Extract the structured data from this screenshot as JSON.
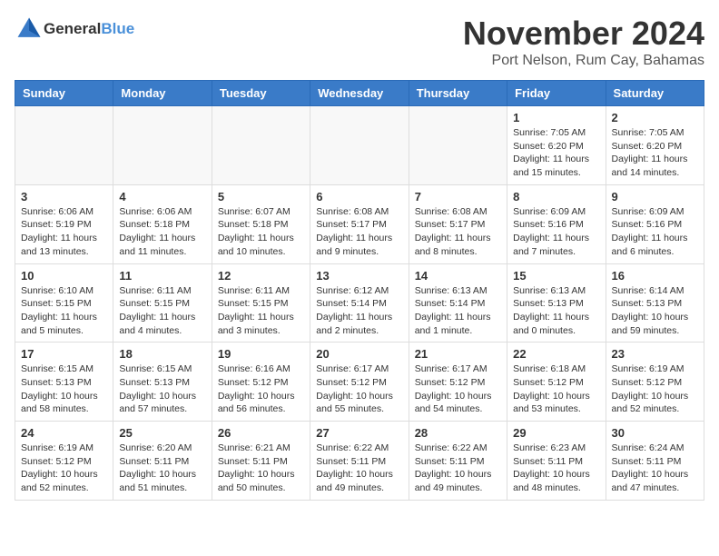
{
  "header": {
    "logo_general": "General",
    "logo_blue": "Blue",
    "month_title": "November 2024",
    "subtitle": "Port Nelson, Rum Cay, Bahamas"
  },
  "weekdays": [
    "Sunday",
    "Monday",
    "Tuesday",
    "Wednesday",
    "Thursday",
    "Friday",
    "Saturday"
  ],
  "weeks": [
    [
      {
        "day": "",
        "info": ""
      },
      {
        "day": "",
        "info": ""
      },
      {
        "day": "",
        "info": ""
      },
      {
        "day": "",
        "info": ""
      },
      {
        "day": "",
        "info": ""
      },
      {
        "day": "1",
        "info": "Sunrise: 7:05 AM\nSunset: 6:20 PM\nDaylight: 11 hours and 15 minutes."
      },
      {
        "day": "2",
        "info": "Sunrise: 7:05 AM\nSunset: 6:20 PM\nDaylight: 11 hours and 14 minutes."
      }
    ],
    [
      {
        "day": "3",
        "info": "Sunrise: 6:06 AM\nSunset: 5:19 PM\nDaylight: 11 hours and 13 minutes."
      },
      {
        "day": "4",
        "info": "Sunrise: 6:06 AM\nSunset: 5:18 PM\nDaylight: 11 hours and 11 minutes."
      },
      {
        "day": "5",
        "info": "Sunrise: 6:07 AM\nSunset: 5:18 PM\nDaylight: 11 hours and 10 minutes."
      },
      {
        "day": "6",
        "info": "Sunrise: 6:08 AM\nSunset: 5:17 PM\nDaylight: 11 hours and 9 minutes."
      },
      {
        "day": "7",
        "info": "Sunrise: 6:08 AM\nSunset: 5:17 PM\nDaylight: 11 hours and 8 minutes."
      },
      {
        "day": "8",
        "info": "Sunrise: 6:09 AM\nSunset: 5:16 PM\nDaylight: 11 hours and 7 minutes."
      },
      {
        "day": "9",
        "info": "Sunrise: 6:09 AM\nSunset: 5:16 PM\nDaylight: 11 hours and 6 minutes."
      }
    ],
    [
      {
        "day": "10",
        "info": "Sunrise: 6:10 AM\nSunset: 5:15 PM\nDaylight: 11 hours and 5 minutes."
      },
      {
        "day": "11",
        "info": "Sunrise: 6:11 AM\nSunset: 5:15 PM\nDaylight: 11 hours and 4 minutes."
      },
      {
        "day": "12",
        "info": "Sunrise: 6:11 AM\nSunset: 5:15 PM\nDaylight: 11 hours and 3 minutes."
      },
      {
        "day": "13",
        "info": "Sunrise: 6:12 AM\nSunset: 5:14 PM\nDaylight: 11 hours and 2 minutes."
      },
      {
        "day": "14",
        "info": "Sunrise: 6:13 AM\nSunset: 5:14 PM\nDaylight: 11 hours and 1 minute."
      },
      {
        "day": "15",
        "info": "Sunrise: 6:13 AM\nSunset: 5:13 PM\nDaylight: 11 hours and 0 minutes."
      },
      {
        "day": "16",
        "info": "Sunrise: 6:14 AM\nSunset: 5:13 PM\nDaylight: 10 hours and 59 minutes."
      }
    ],
    [
      {
        "day": "17",
        "info": "Sunrise: 6:15 AM\nSunset: 5:13 PM\nDaylight: 10 hours and 58 minutes."
      },
      {
        "day": "18",
        "info": "Sunrise: 6:15 AM\nSunset: 5:13 PM\nDaylight: 10 hours and 57 minutes."
      },
      {
        "day": "19",
        "info": "Sunrise: 6:16 AM\nSunset: 5:12 PM\nDaylight: 10 hours and 56 minutes."
      },
      {
        "day": "20",
        "info": "Sunrise: 6:17 AM\nSunset: 5:12 PM\nDaylight: 10 hours and 55 minutes."
      },
      {
        "day": "21",
        "info": "Sunrise: 6:17 AM\nSunset: 5:12 PM\nDaylight: 10 hours and 54 minutes."
      },
      {
        "day": "22",
        "info": "Sunrise: 6:18 AM\nSunset: 5:12 PM\nDaylight: 10 hours and 53 minutes."
      },
      {
        "day": "23",
        "info": "Sunrise: 6:19 AM\nSunset: 5:12 PM\nDaylight: 10 hours and 52 minutes."
      }
    ],
    [
      {
        "day": "24",
        "info": "Sunrise: 6:19 AM\nSunset: 5:12 PM\nDaylight: 10 hours and 52 minutes."
      },
      {
        "day": "25",
        "info": "Sunrise: 6:20 AM\nSunset: 5:11 PM\nDaylight: 10 hours and 51 minutes."
      },
      {
        "day": "26",
        "info": "Sunrise: 6:21 AM\nSunset: 5:11 PM\nDaylight: 10 hours and 50 minutes."
      },
      {
        "day": "27",
        "info": "Sunrise: 6:22 AM\nSunset: 5:11 PM\nDaylight: 10 hours and 49 minutes."
      },
      {
        "day": "28",
        "info": "Sunrise: 6:22 AM\nSunset: 5:11 PM\nDaylight: 10 hours and 49 minutes."
      },
      {
        "day": "29",
        "info": "Sunrise: 6:23 AM\nSunset: 5:11 PM\nDaylight: 10 hours and 48 minutes."
      },
      {
        "day": "30",
        "info": "Sunrise: 6:24 AM\nSunset: 5:11 PM\nDaylight: 10 hours and 47 minutes."
      }
    ]
  ]
}
